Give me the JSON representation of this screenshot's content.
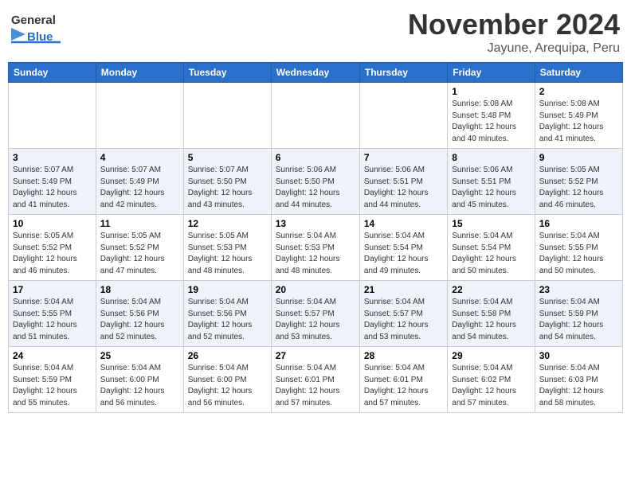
{
  "header": {
    "logo_general": "General",
    "logo_blue": "Blue",
    "month": "November 2024",
    "location": "Jayune, Arequipa, Peru"
  },
  "weekdays": [
    "Sunday",
    "Monday",
    "Tuesday",
    "Wednesday",
    "Thursday",
    "Friday",
    "Saturday"
  ],
  "weeks": [
    [
      {
        "day": "",
        "info": ""
      },
      {
        "day": "",
        "info": ""
      },
      {
        "day": "",
        "info": ""
      },
      {
        "day": "",
        "info": ""
      },
      {
        "day": "",
        "info": ""
      },
      {
        "day": "1",
        "info": "Sunrise: 5:08 AM\nSunset: 5:48 PM\nDaylight: 12 hours\nand 40 minutes."
      },
      {
        "day": "2",
        "info": "Sunrise: 5:08 AM\nSunset: 5:49 PM\nDaylight: 12 hours\nand 41 minutes."
      }
    ],
    [
      {
        "day": "3",
        "info": "Sunrise: 5:07 AM\nSunset: 5:49 PM\nDaylight: 12 hours\nand 41 minutes."
      },
      {
        "day": "4",
        "info": "Sunrise: 5:07 AM\nSunset: 5:49 PM\nDaylight: 12 hours\nand 42 minutes."
      },
      {
        "day": "5",
        "info": "Sunrise: 5:07 AM\nSunset: 5:50 PM\nDaylight: 12 hours\nand 43 minutes."
      },
      {
        "day": "6",
        "info": "Sunrise: 5:06 AM\nSunset: 5:50 PM\nDaylight: 12 hours\nand 44 minutes."
      },
      {
        "day": "7",
        "info": "Sunrise: 5:06 AM\nSunset: 5:51 PM\nDaylight: 12 hours\nand 44 minutes."
      },
      {
        "day": "8",
        "info": "Sunrise: 5:06 AM\nSunset: 5:51 PM\nDaylight: 12 hours\nand 45 minutes."
      },
      {
        "day": "9",
        "info": "Sunrise: 5:05 AM\nSunset: 5:52 PM\nDaylight: 12 hours\nand 46 minutes."
      }
    ],
    [
      {
        "day": "10",
        "info": "Sunrise: 5:05 AM\nSunset: 5:52 PM\nDaylight: 12 hours\nand 46 minutes."
      },
      {
        "day": "11",
        "info": "Sunrise: 5:05 AM\nSunset: 5:52 PM\nDaylight: 12 hours\nand 47 minutes."
      },
      {
        "day": "12",
        "info": "Sunrise: 5:05 AM\nSunset: 5:53 PM\nDaylight: 12 hours\nand 48 minutes."
      },
      {
        "day": "13",
        "info": "Sunrise: 5:04 AM\nSunset: 5:53 PM\nDaylight: 12 hours\nand 48 minutes."
      },
      {
        "day": "14",
        "info": "Sunrise: 5:04 AM\nSunset: 5:54 PM\nDaylight: 12 hours\nand 49 minutes."
      },
      {
        "day": "15",
        "info": "Sunrise: 5:04 AM\nSunset: 5:54 PM\nDaylight: 12 hours\nand 50 minutes."
      },
      {
        "day": "16",
        "info": "Sunrise: 5:04 AM\nSunset: 5:55 PM\nDaylight: 12 hours\nand 50 minutes."
      }
    ],
    [
      {
        "day": "17",
        "info": "Sunrise: 5:04 AM\nSunset: 5:55 PM\nDaylight: 12 hours\nand 51 minutes."
      },
      {
        "day": "18",
        "info": "Sunrise: 5:04 AM\nSunset: 5:56 PM\nDaylight: 12 hours\nand 52 minutes."
      },
      {
        "day": "19",
        "info": "Sunrise: 5:04 AM\nSunset: 5:56 PM\nDaylight: 12 hours\nand 52 minutes."
      },
      {
        "day": "20",
        "info": "Sunrise: 5:04 AM\nSunset: 5:57 PM\nDaylight: 12 hours\nand 53 minutes."
      },
      {
        "day": "21",
        "info": "Sunrise: 5:04 AM\nSunset: 5:57 PM\nDaylight: 12 hours\nand 53 minutes."
      },
      {
        "day": "22",
        "info": "Sunrise: 5:04 AM\nSunset: 5:58 PM\nDaylight: 12 hours\nand 54 minutes."
      },
      {
        "day": "23",
        "info": "Sunrise: 5:04 AM\nSunset: 5:59 PM\nDaylight: 12 hours\nand 54 minutes."
      }
    ],
    [
      {
        "day": "24",
        "info": "Sunrise: 5:04 AM\nSunset: 5:59 PM\nDaylight: 12 hours\nand 55 minutes."
      },
      {
        "day": "25",
        "info": "Sunrise: 5:04 AM\nSunset: 6:00 PM\nDaylight: 12 hours\nand 56 minutes."
      },
      {
        "day": "26",
        "info": "Sunrise: 5:04 AM\nSunset: 6:00 PM\nDaylight: 12 hours\nand 56 minutes."
      },
      {
        "day": "27",
        "info": "Sunrise: 5:04 AM\nSunset: 6:01 PM\nDaylight: 12 hours\nand 57 minutes."
      },
      {
        "day": "28",
        "info": "Sunrise: 5:04 AM\nSunset: 6:01 PM\nDaylight: 12 hours\nand 57 minutes."
      },
      {
        "day": "29",
        "info": "Sunrise: 5:04 AM\nSunset: 6:02 PM\nDaylight: 12 hours\nand 57 minutes."
      },
      {
        "day": "30",
        "info": "Sunrise: 5:04 AM\nSunset: 6:03 PM\nDaylight: 12 hours\nand 58 minutes."
      }
    ]
  ]
}
